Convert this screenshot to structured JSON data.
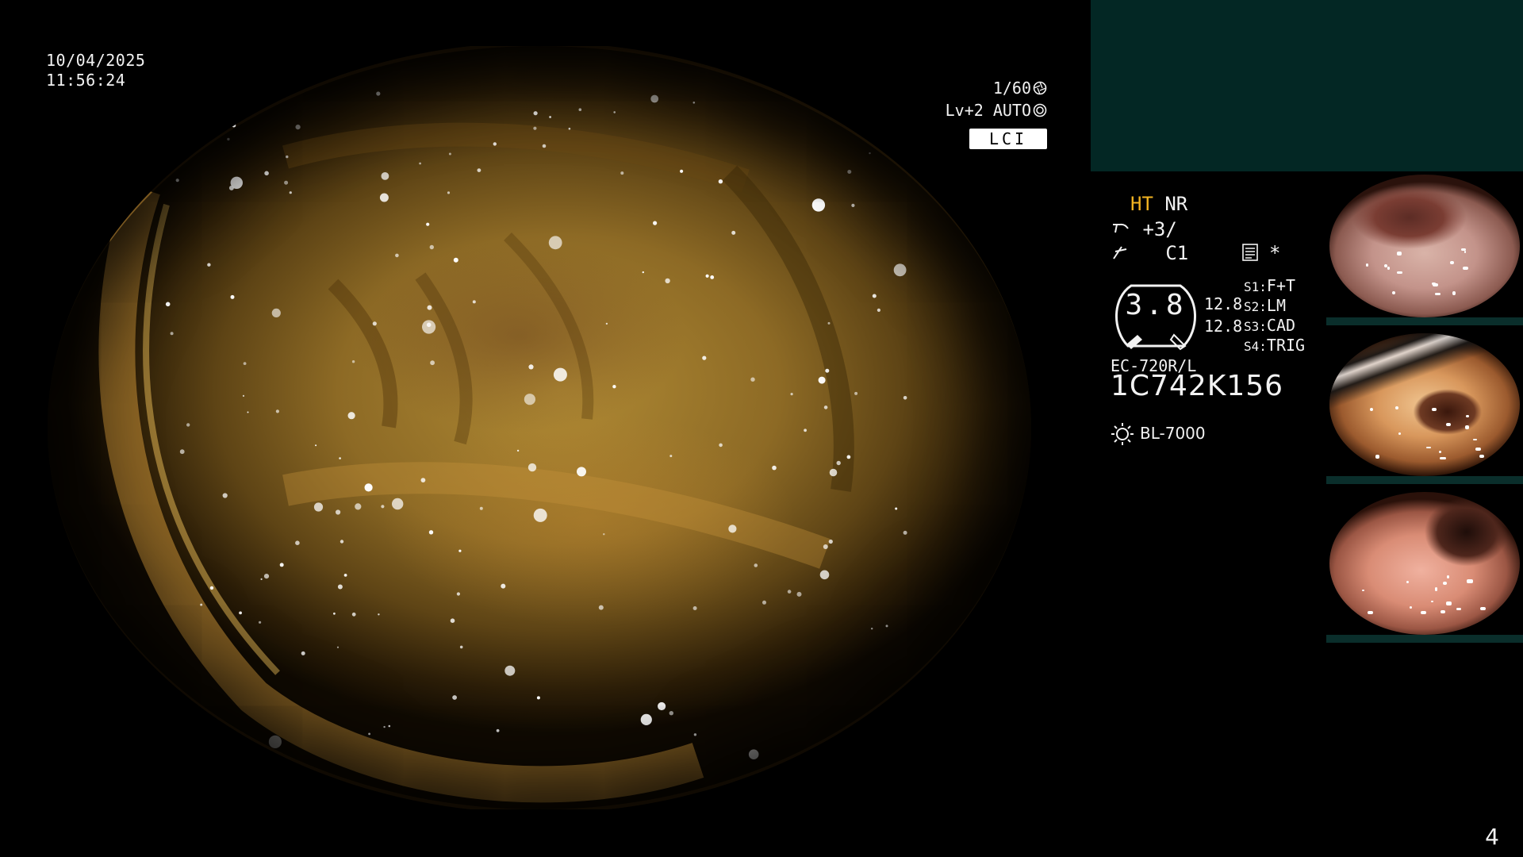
{
  "osd": {
    "date": "10/04/2025",
    "time": "11:56:24",
    "shutter": "1/60",
    "agc_level": "Lv+2",
    "iris_mode": "AUTO",
    "image_mode": "LCI"
  },
  "panel": {
    "ht": "HT",
    "nr": "NR",
    "enhancement": "+3/",
    "color": "C1",
    "asterisk": "*",
    "gauge_value": "3.8",
    "gauge_r1": "12.8",
    "gauge_r2": "12.8",
    "switches": [
      {
        "key": "S1:",
        "value": "F+T"
      },
      {
        "key": "S2:",
        "value": "LM"
      },
      {
        "key": "S3:",
        "value": "CAD"
      },
      {
        "key": "S4:",
        "value": "TRIG"
      }
    ],
    "scope_model": "EC-720R/L",
    "serial": "1C742K156",
    "light_source": "BL-7000"
  },
  "page_number": "4",
  "icons": {
    "shutter": "aperture-icon",
    "iris": "iris-icon",
    "enhancement": "structure-enhancement-icon",
    "color": "color-enhancement-icon",
    "record": "record-list-icon",
    "light": "light-source-icon"
  },
  "colors": {
    "ht_label": "#f2b321",
    "info_banner": "#032724"
  }
}
